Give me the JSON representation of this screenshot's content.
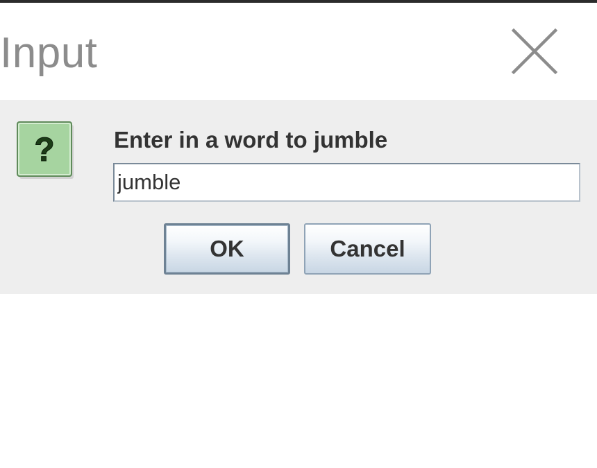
{
  "window": {
    "title": "Input"
  },
  "dialog": {
    "prompt": "Enter in a word to jumble",
    "input_value": "jumble",
    "buttons": {
      "ok_label": "OK",
      "cancel_label": "Cancel"
    }
  },
  "icons": {
    "close": "close-icon",
    "question": "question-icon",
    "question_glyph": "?"
  },
  "colors": {
    "title_text": "#8c8c8c",
    "dialog_background": "#eeeeee",
    "question_icon_fill": "#a6d4a0",
    "question_mark": "#1b3d17",
    "button_border": "#6e8294"
  }
}
